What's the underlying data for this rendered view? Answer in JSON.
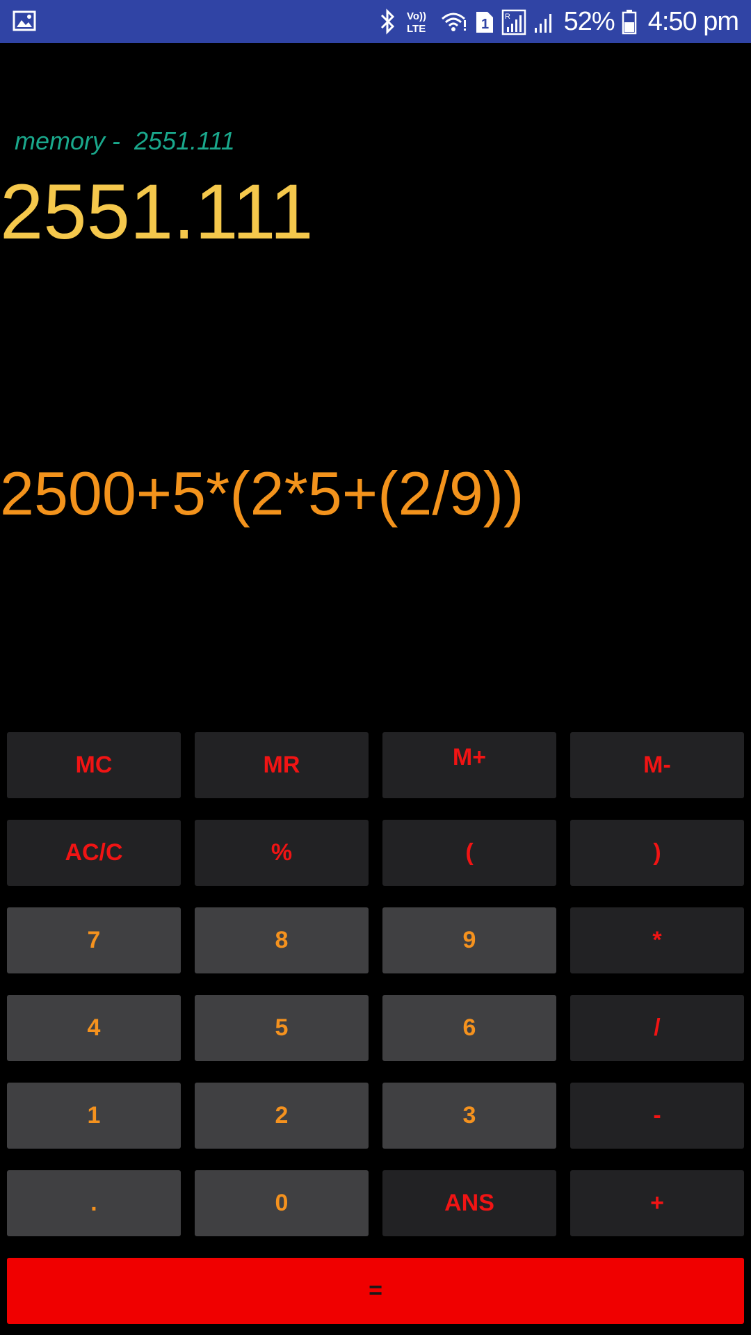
{
  "status_bar": {
    "battery_percent": "52%",
    "time": "4:50 pm",
    "sim_slot": "1",
    "network_label": "Vo)) LTE",
    "icons": [
      "gallery-icon",
      "bluetooth-icon",
      "volte-icon",
      "wifi-icon",
      "sim-icon",
      "roaming-signal-icon",
      "signal-icon",
      "battery-icon"
    ]
  },
  "display": {
    "memory_text": "memory -  2551.111",
    "result": "2551.111",
    "expression": "2500+5*(2*5+(2/9))"
  },
  "keypad": {
    "row1": [
      "MC",
      "MR",
      "M+",
      "M-"
    ],
    "row2": [
      "AC/C",
      "%",
      "(",
      ")"
    ],
    "row3": [
      "7",
      "8",
      "9",
      "*"
    ],
    "row4": [
      "4",
      "5",
      "6",
      "/"
    ],
    "row5": [
      "1",
      "2",
      "3",
      "-"
    ],
    "row6": [
      ".",
      "0",
      "ANS",
      "+"
    ],
    "equals": "="
  },
  "colors": {
    "status_bar": "#3044a5",
    "memory": "#1aa88c",
    "result": "#f5c84c",
    "expression": "#f3931c",
    "function_key_bg": "#222224",
    "digit_key_bg": "#404042",
    "function_text": "#f11414",
    "digit_text": "#f5921e",
    "equals_bg": "#f00000"
  }
}
